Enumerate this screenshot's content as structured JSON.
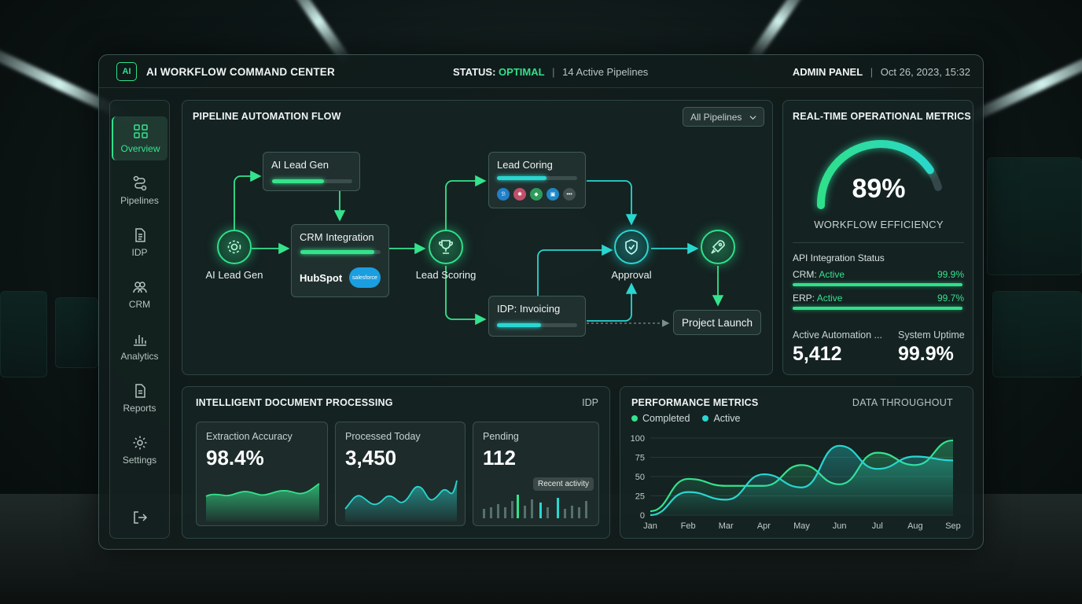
{
  "app": {
    "logo_text": "AI",
    "title": "AI WORKFLOW COMMAND CENTER",
    "status_label": "STATUS:",
    "status_value": "OPTIMAL",
    "active_pipelines": "14 Active Pipelines",
    "admin": "ADMIN PANEL",
    "datetime": "Oct 26, 2023, 15:32"
  },
  "sidebar": {
    "items": [
      {
        "label": "Overview",
        "icon": "grid-icon"
      },
      {
        "label": "Pipelines",
        "icon": "pipeline-icon"
      },
      {
        "label": "IDP",
        "icon": "document-icon"
      },
      {
        "label": "CRM",
        "icon": "users-icon"
      },
      {
        "label": "Analytics",
        "icon": "bar-chart-icon"
      },
      {
        "label": "Reports",
        "icon": "report-icon"
      },
      {
        "label": "Settings",
        "icon": "gear-icon"
      }
    ],
    "logout_icon": "logout-icon"
  },
  "pipeline": {
    "title": "PIPELINE AUTOMATION FLOW",
    "filter": "All Pipelines",
    "cards": {
      "lead_gen": {
        "title": "AI Lead Gen",
        "progress": 0.65
      },
      "crm": {
        "title": "CRM Integration",
        "progress": 0.92,
        "logos": [
          "HubSpot",
          "salesforce"
        ]
      },
      "coring": {
        "title": "Lead Coring",
        "progress": 0.62
      },
      "idp": {
        "title": "IDP: Invoicing",
        "progress": 0.55
      }
    },
    "nodes": {
      "lead_gen": "AI Lead Gen",
      "scoring": "Lead Scoring",
      "approval": "Approval",
      "launch": "Project Launch"
    }
  },
  "metrics": {
    "title": "REAL-TIME OPERATIONAL METRICS",
    "efficiency": "89%",
    "efficiency_value": 0.89,
    "efficiency_label": "WORKFLOW EFFICIENCY",
    "api_title": "API Integration Status",
    "api": [
      {
        "name": "CRM:",
        "status": "Active",
        "pct": "99.9%"
      },
      {
        "name": "ERP:",
        "status": "Active",
        "pct": "99.7%"
      }
    ],
    "stats": [
      {
        "label": "Active Automation ...",
        "value": "5,412"
      },
      {
        "label": "System Uptime",
        "value": "99.9%"
      }
    ]
  },
  "idp": {
    "title": "INTELLIGENT DOCUMENT PROCESSING",
    "tag": "IDP",
    "kpis": [
      {
        "label": "Extraction Accuracy",
        "value": "98.4%"
      },
      {
        "label": "Processed Today",
        "value": "3,450"
      },
      {
        "label": "Pending",
        "value": "112",
        "tooltip": "Recent activity"
      }
    ]
  },
  "performance": {
    "title": "PERFORMANCE METRICS",
    "tag": "DATA THROUGHOUT",
    "legend": [
      {
        "name": "Completed",
        "color": "#35e38c"
      },
      {
        "name": "Active",
        "color": "#2ad6d0"
      }
    ]
  },
  "chart_data": {
    "type": "line",
    "x": [
      "Jan",
      "Feb",
      "Mar",
      "Apr",
      "May",
      "Jun",
      "Jul",
      "Aug",
      "Sep"
    ],
    "yticks": [
      0,
      25,
      50,
      75,
      100
    ],
    "ylim": [
      0,
      100
    ],
    "series": [
      {
        "name": "Completed",
        "color": "#35e38c",
        "values": [
          5,
          47,
          38,
          38,
          65,
          40,
          81,
          65,
          97
        ]
      },
      {
        "name": "Active",
        "color": "#2ad6d0",
        "values": [
          0,
          30,
          20,
          53,
          36,
          90,
          60,
          76,
          71
        ]
      }
    ],
    "title": "PERFORMANCE METRICS",
    "legend_position": "top-left",
    "grid": true
  }
}
